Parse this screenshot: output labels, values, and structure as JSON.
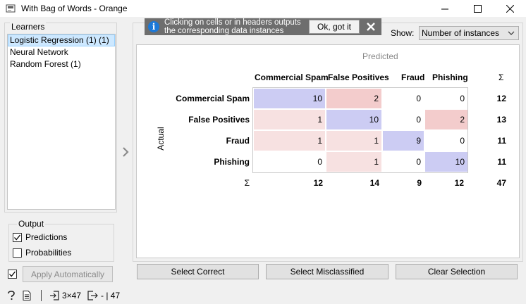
{
  "window": {
    "title": "With Bag of Words - Orange",
    "minimize_icon": "minimize-icon",
    "maximize_icon": "maximize-icon",
    "close_icon": "close-icon"
  },
  "learners": {
    "legend": "Learners",
    "items": [
      {
        "label": "Logistic Regression (1) (1)",
        "selected": true
      },
      {
        "label": "Neural Network",
        "selected": false
      },
      {
        "label": "Random Forest (1)",
        "selected": false
      }
    ]
  },
  "output": {
    "legend": "Output",
    "predictions_label": "Predictions",
    "predictions_checked": true,
    "probabilities_label": "Probabilities",
    "probabilities_checked": false
  },
  "apply": {
    "checked": true,
    "label": "Apply Automatically"
  },
  "statusbar": {
    "help_icon": "help-icon",
    "report_icon": "report-icon",
    "input_icon": "input-icon",
    "input_summary": "3×47",
    "output_icon": "output-icon",
    "output_summary": "- | 47"
  },
  "banner": {
    "info_icon": "info-icon",
    "line1": "Clicking on cells or in headers outputs",
    "line2": "the corresponding data instances",
    "ok_label": "Ok, got it",
    "close_icon": "close-icon"
  },
  "show": {
    "label": "Show:",
    "value": "Number of instances"
  },
  "matrix": {
    "predicted_label": "Predicted",
    "actual_label": "Actual",
    "sigma": "Σ",
    "columns": [
      "Commercial Spam",
      "False Positives",
      "Fraud",
      "Phishing"
    ],
    "rows": [
      {
        "label": "Commercial Spam",
        "cells": [
          "10",
          "2",
          "0",
          "0"
        ],
        "sum": "12"
      },
      {
        "label": "False Positives",
        "cells": [
          "1",
          "10",
          "0",
          "2"
        ],
        "sum": "13"
      },
      {
        "label": "Fraud",
        "cells": [
          "1",
          "1",
          "9",
          "0"
        ],
        "sum": "11"
      },
      {
        "label": "Phishing",
        "cells": [
          "0",
          "1",
          "0",
          "10"
        ],
        "sum": "11"
      }
    ],
    "col_sums": [
      "12",
      "14",
      "9",
      "12"
    ],
    "total": "47",
    "colors": {
      "diagonal": "#ccccf3",
      "error_strong": "#f3cccc",
      "error_weak": "#f7e1e1",
      "empty": "#ffffff"
    }
  },
  "buttons": {
    "select_correct": "Select Correct",
    "select_misclassified": "Select Misclassified",
    "clear_selection": "Clear Selection"
  }
}
